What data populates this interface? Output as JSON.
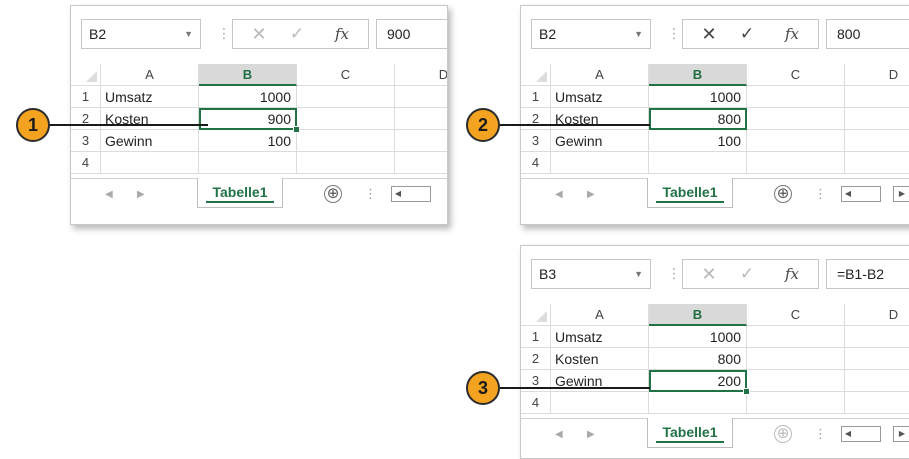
{
  "panels": [
    {
      "name_box": "B2",
      "formula": "900",
      "formula_buttons_active": true,
      "columns": [
        "A",
        "B",
        "C",
        "D"
      ],
      "active_column": "B",
      "rows": [
        {
          "num": "1",
          "a": "Umsatz",
          "b": "1000"
        },
        {
          "num": "2",
          "a": "Kosten",
          "b": "900"
        },
        {
          "num": "3",
          "a": "Gewinn",
          "b": "100"
        },
        {
          "num": "4",
          "a": "",
          "b": ""
        }
      ],
      "selected_row": 2,
      "sheet_tab": "Tabelle1",
      "add_sheet": "⊕",
      "callout": "1"
    },
    {
      "name_box": "B2",
      "formula": "800",
      "formula_buttons_active": true,
      "columns": [
        "A",
        "B",
        "C",
        "D"
      ],
      "active_column": "B",
      "rows": [
        {
          "num": "1",
          "a": "Umsatz",
          "b": "1000"
        },
        {
          "num": "2",
          "a": "Kosten",
          "b": "800"
        },
        {
          "num": "3",
          "a": "Gewinn",
          "b": "100"
        },
        {
          "num": "4",
          "a": "",
          "b": ""
        }
      ],
      "selected_row": 2,
      "sheet_tab": "Tabelle1",
      "add_sheet": "⊕",
      "callout": "2"
    },
    {
      "name_box": "B3",
      "formula": "=B1-B2",
      "formula_buttons_active": false,
      "columns": [
        "A",
        "B",
        "C",
        "D"
      ],
      "active_column": "B",
      "rows": [
        {
          "num": "1",
          "a": "Umsatz",
          "b": "1000"
        },
        {
          "num": "2",
          "a": "Kosten",
          "b": "800"
        },
        {
          "num": "3",
          "a": "Gewinn",
          "b": "200"
        },
        {
          "num": "4",
          "a": "",
          "b": ""
        }
      ],
      "selected_row": 3,
      "sheet_tab": "Tabelle1",
      "add_sheet": "⊕",
      "callout": "3"
    }
  ],
  "icons": {
    "cancel": "✕",
    "enter": "✓",
    "fx": "fx",
    "dropdown": "▼",
    "nav_left": "◀",
    "nav_right": "▶"
  },
  "colors": {
    "accent": "#217346",
    "badge": "#f3a31f"
  }
}
